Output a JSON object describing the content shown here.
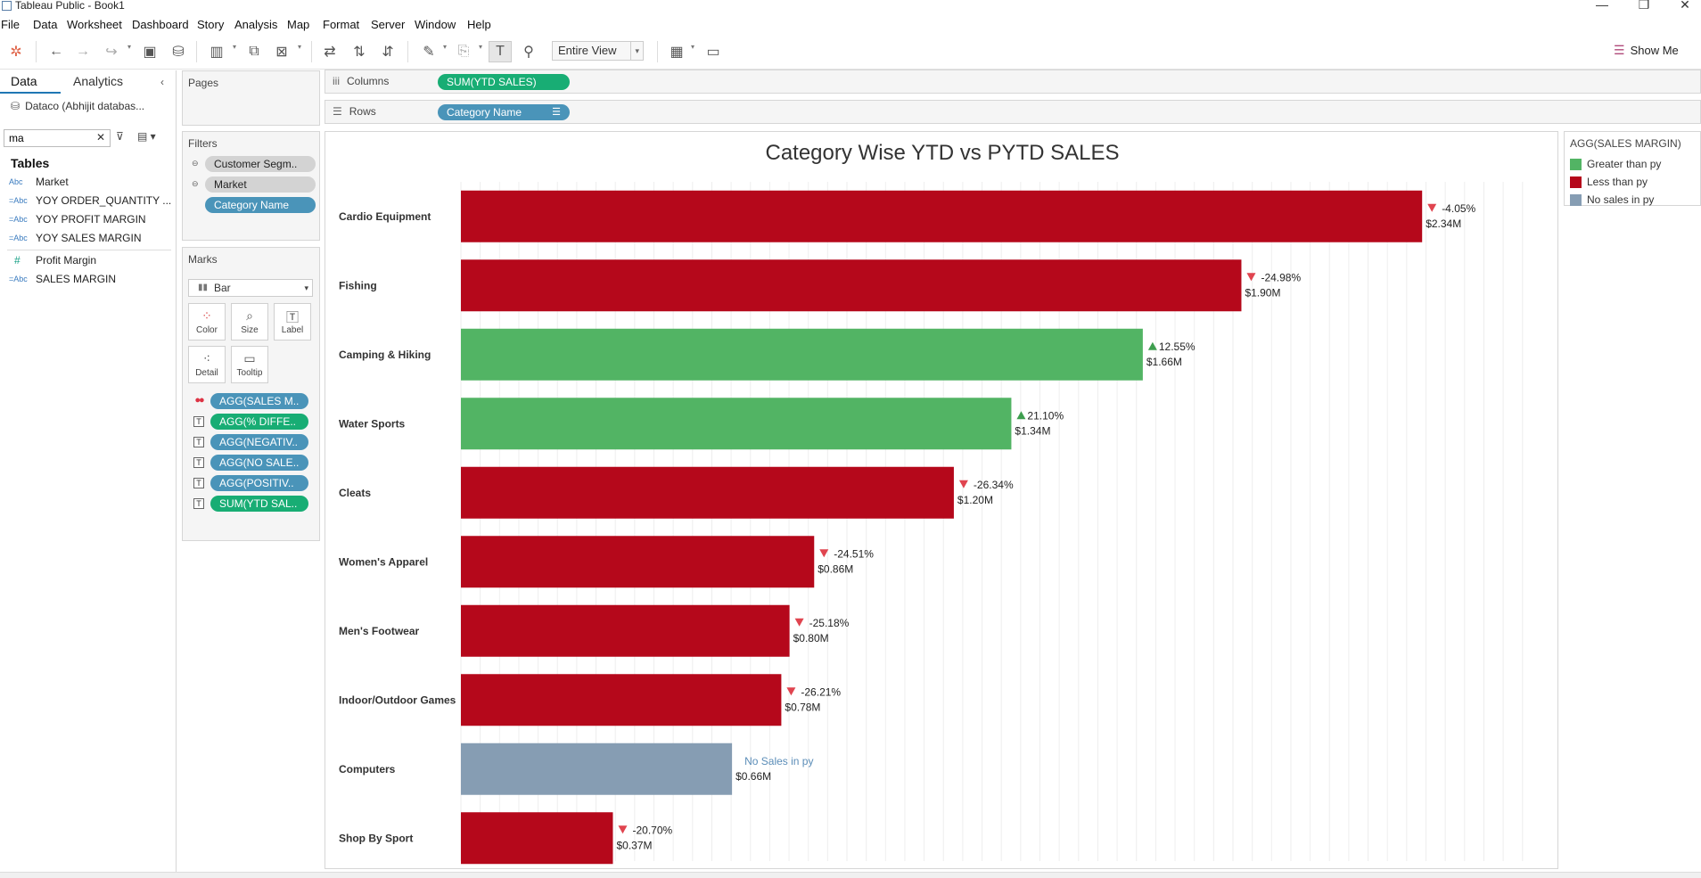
{
  "window": {
    "title": "Tableau Public - Book1",
    "controls": [
      "—",
      "❐",
      "✕"
    ]
  },
  "menu": [
    "File",
    "Data",
    "Worksheet",
    "Dashboard",
    "Story",
    "Analysis",
    "Map",
    "Format",
    "Server",
    "Window",
    "Help"
  ],
  "toolbar": {
    "fit_label": "Entire View",
    "show_me_label": "Show Me"
  },
  "data_pane": {
    "tab_data": "Data",
    "tab_analytics": "Analytics",
    "datasource": "Dataco (Abhijit databas...",
    "search_value": "ma",
    "tables_heading": "Tables",
    "fields": [
      {
        "type": "Abc",
        "name": "Market"
      },
      {
        "type": "=Abc",
        "name": "YOY ORDER_QUANTITY ..."
      },
      {
        "type": "=Abc",
        "name": "YOY PROFIT MARGIN"
      },
      {
        "type": "=Abc",
        "name": "YOY SALES MARGIN"
      },
      {
        "type": "#",
        "name": "Profit Margin"
      },
      {
        "type": "=Abc",
        "name": "SALES MARGIN"
      }
    ]
  },
  "cards": {
    "pages_title": "Pages",
    "filters_title": "Filters",
    "filters": [
      "Customer Segm..",
      "Market",
      "Category Name"
    ],
    "marks_title": "Marks",
    "mark_type": "Bar",
    "mark_buttons": [
      "Color",
      "Size",
      "Label",
      "Detail",
      "Tooltip"
    ],
    "mark_fields": [
      "AGG(SALES M..",
      "AGG(% DIFFE..",
      "AGG(NEGATIV..",
      "AGG(NO SALE..",
      "AGG(POSITIV..",
      "SUM(YTD SAL.."
    ]
  },
  "shelves": {
    "columns_label": "Columns",
    "columns_pill": "SUM(YTD SALES)",
    "rows_label": "Rows",
    "rows_pill": "Category Name"
  },
  "legend": {
    "title": "AGG(SALES MARGIN)",
    "items": [
      {
        "label": "Greater than py",
        "color": "#52b464"
      },
      {
        "label": "Less than py",
        "color": "#b5081b"
      },
      {
        "label": "No sales in py",
        "color": "#869db3"
      }
    ]
  },
  "chart_data": {
    "type": "bar",
    "title": "Category Wise YTD vs PYTD SALES",
    "orientation": "horizontal",
    "grid": "vertical gridlines",
    "colors": {
      "greater": "#52b464",
      "less": "#b5081b",
      "none": "#869db3",
      "up_arrow": "#3e9e4e",
      "down_arrow": "#e0444f",
      "no_sales_text": "#5b8db8"
    },
    "xlim": [
      0,
      2.6
    ],
    "categories": [
      "Cardio Equipment",
      "Fishing",
      "Camping & Hiking",
      "Water Sports",
      "Cleats",
      "Women's Apparel",
      "Men's Footwear",
      "Indoor/Outdoor Games",
      "Computers",
      "Shop By Sport"
    ],
    "values": [
      2.34,
      1.9,
      1.66,
      1.34,
      1.2,
      0.86,
      0.8,
      0.78,
      0.66,
      0.37
    ],
    "value_labels": [
      "$2.34M",
      "$1.90M",
      "$1.66M",
      "$1.34M",
      "$1.20M",
      "$0.86M",
      "$0.80M",
      "$0.78M",
      "$0.66M",
      "$0.37M"
    ],
    "pct_labels": [
      "-4.05%",
      "-24.98%",
      "12.55%",
      "21.10%",
      "-26.34%",
      "-24.51%",
      "-25.18%",
      "-26.21%",
      "No Sales in py",
      "-20.70%"
    ],
    "status": [
      "less",
      "less",
      "greater",
      "greater",
      "less",
      "less",
      "less",
      "less",
      "none",
      "less"
    ]
  }
}
